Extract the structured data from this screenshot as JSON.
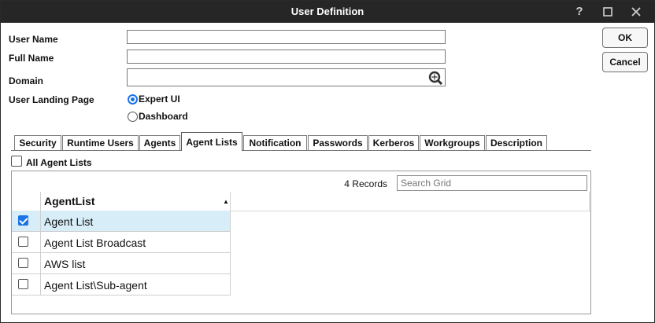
{
  "window": {
    "title": "User Definition"
  },
  "titlebar": {
    "help": "?",
    "maximize": "☐",
    "close": "✕"
  },
  "form": {
    "user_name_label": "User Name",
    "user_name_value": "",
    "full_name_label": "Full Name",
    "full_name_value": "",
    "domain_label": "Domain",
    "domain_value": "",
    "landing_label": "User Landing Page",
    "landing_options": [
      "Expert UI",
      "Dashboard"
    ],
    "landing_selected": "Expert UI"
  },
  "buttons": {
    "ok": "OK",
    "cancel": "Cancel"
  },
  "tabs": [
    "Security",
    "Runtime Users",
    "Agents",
    "Agent Lists",
    "Notification",
    "Passwords",
    "Kerberos",
    "Workgroups",
    "Description"
  ],
  "active_tab": "Agent Lists",
  "all_agent_lists_label": "All Agent Lists",
  "grid": {
    "records": "4 Records",
    "search_placeholder": "Search Grid",
    "column": "AgentList",
    "rows": [
      {
        "label": "Agent List",
        "checked": true
      },
      {
        "label": "Agent List Broadcast",
        "checked": false
      },
      {
        "label": "AWS list",
        "checked": false
      },
      {
        "label": "Agent List\\Sub-agent",
        "checked": false
      }
    ]
  },
  "colors": {
    "titlebar": "#262626",
    "accent": "#1a73e8",
    "selected_row": "#d7edf7"
  }
}
